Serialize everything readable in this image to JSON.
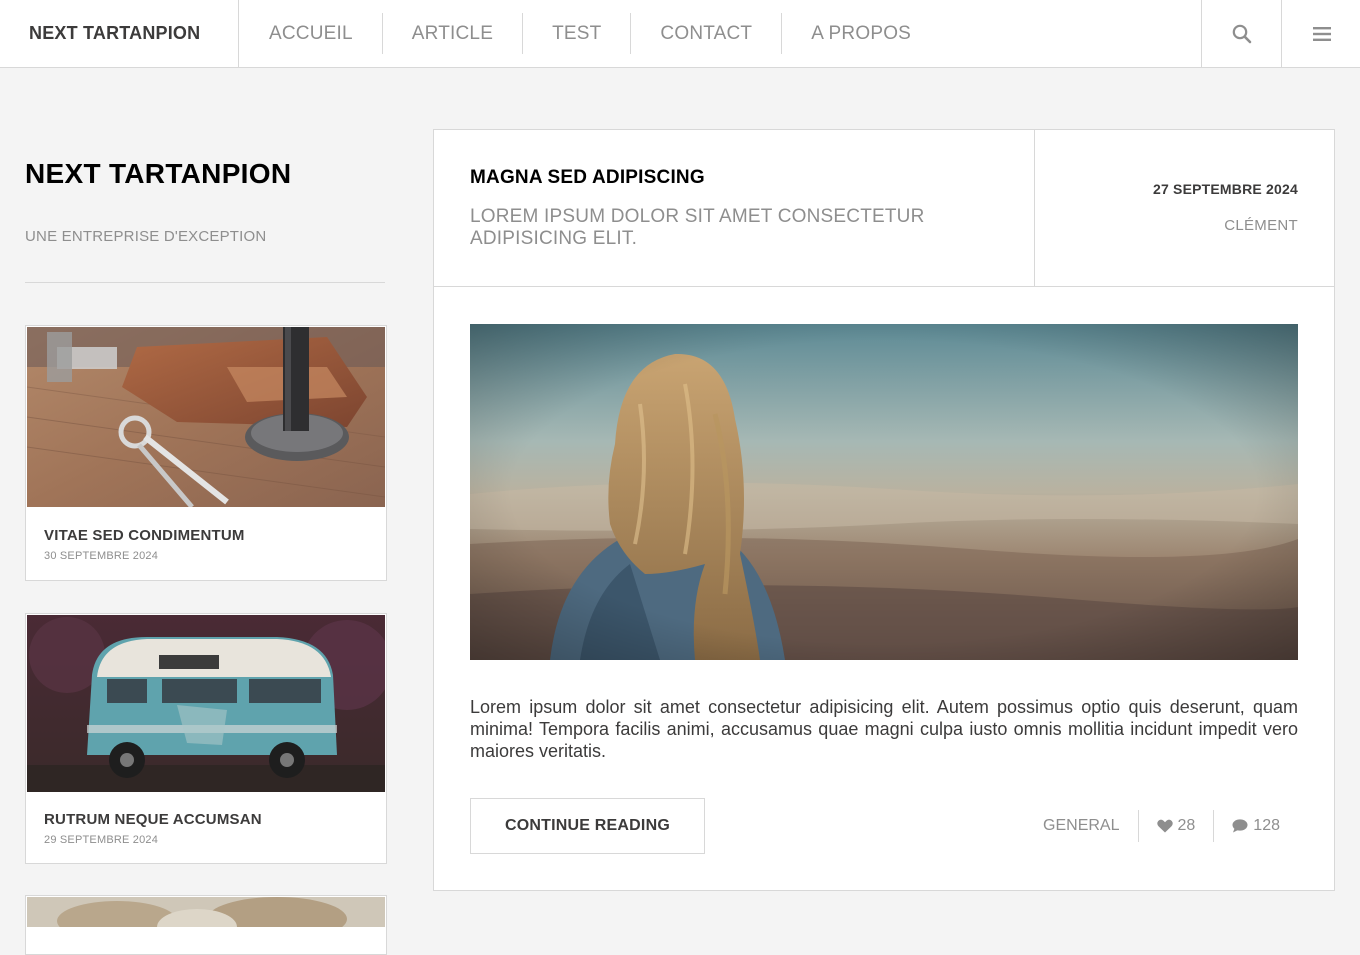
{
  "header": {
    "brand": "NEXT TARTANPION",
    "nav": [
      "ACCUEIL",
      "ARTICLE",
      "TEST",
      "CONTACT",
      "A PROPOS"
    ],
    "search_icon": "search-icon",
    "menu_icon": "hamburger-menu-icon"
  },
  "sidebar": {
    "title": "NEXT TARTANPION",
    "subtitle": "UNE ENTREPRISE D'EXCEPTION",
    "posts": [
      {
        "title": "VITAE SED CONDIMENTUM",
        "date": "30 SEPTEMBRE 2024",
        "image": "desk-tools-photo"
      },
      {
        "title": "RUTRUM NEQUE ACCUMSAN",
        "date": "29 SEPTEMBRE 2024",
        "image": "blue-van-photo"
      },
      {
        "title": "",
        "date": "",
        "image": "fluffy-animal-photo"
      }
    ]
  },
  "article": {
    "title": "MAGNA SED ADIPISCING",
    "subtitle": "LOREM IPSUM DOLOR SIT AMET CONSECTETUR ADIPISICING ELIT.",
    "date": "27 SEPTEMBRE 2024",
    "author": "CLÉMENT",
    "image": "woman-looking-at-landscape-photo",
    "body": "Lorem ipsum dolor sit amet consectetur adipisicing elit. Autem possimus optio quis deserunt, quam minima! Tempora facilis animi, accusamus quae magni culpa iusto omnis mollitia incidunt impedit vero maiores veritatis.",
    "continue_label": "CONTINUE READING",
    "category": "GENERAL",
    "likes": "28",
    "comments": "128"
  },
  "colors": {
    "background": "#f4f4f4",
    "text": "#3c3b3b",
    "muted": "#8e8e8e",
    "border": "#d8d8d8"
  }
}
